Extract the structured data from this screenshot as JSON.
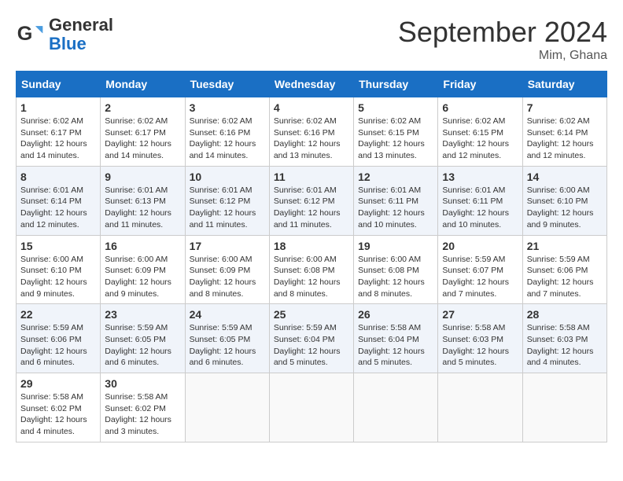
{
  "logo": {
    "text_general": "General",
    "text_blue": "Blue"
  },
  "title": "September 2024",
  "location": "Mim, Ghana",
  "days_of_week": [
    "Sunday",
    "Monday",
    "Tuesday",
    "Wednesday",
    "Thursday",
    "Friday",
    "Saturday"
  ],
  "weeks": [
    [
      {
        "day": "1",
        "sunrise": "6:02 AM",
        "sunset": "6:17 PM",
        "daylight": "12 hours and 14 minutes."
      },
      {
        "day": "2",
        "sunrise": "6:02 AM",
        "sunset": "6:17 PM",
        "daylight": "12 hours and 14 minutes."
      },
      {
        "day": "3",
        "sunrise": "6:02 AM",
        "sunset": "6:16 PM",
        "daylight": "12 hours and 14 minutes."
      },
      {
        "day": "4",
        "sunrise": "6:02 AM",
        "sunset": "6:16 PM",
        "daylight": "12 hours and 13 minutes."
      },
      {
        "day": "5",
        "sunrise": "6:02 AM",
        "sunset": "6:15 PM",
        "daylight": "12 hours and 13 minutes."
      },
      {
        "day": "6",
        "sunrise": "6:02 AM",
        "sunset": "6:15 PM",
        "daylight": "12 hours and 12 minutes."
      },
      {
        "day": "7",
        "sunrise": "6:02 AM",
        "sunset": "6:14 PM",
        "daylight": "12 hours and 12 minutes."
      }
    ],
    [
      {
        "day": "8",
        "sunrise": "6:01 AM",
        "sunset": "6:14 PM",
        "daylight": "12 hours and 12 minutes."
      },
      {
        "day": "9",
        "sunrise": "6:01 AM",
        "sunset": "6:13 PM",
        "daylight": "12 hours and 11 minutes."
      },
      {
        "day": "10",
        "sunrise": "6:01 AM",
        "sunset": "6:12 PM",
        "daylight": "12 hours and 11 minutes."
      },
      {
        "day": "11",
        "sunrise": "6:01 AM",
        "sunset": "6:12 PM",
        "daylight": "12 hours and 11 minutes."
      },
      {
        "day": "12",
        "sunrise": "6:01 AM",
        "sunset": "6:11 PM",
        "daylight": "12 hours and 10 minutes."
      },
      {
        "day": "13",
        "sunrise": "6:01 AM",
        "sunset": "6:11 PM",
        "daylight": "12 hours and 10 minutes."
      },
      {
        "day": "14",
        "sunrise": "6:00 AM",
        "sunset": "6:10 PM",
        "daylight": "12 hours and 9 minutes."
      }
    ],
    [
      {
        "day": "15",
        "sunrise": "6:00 AM",
        "sunset": "6:10 PM",
        "daylight": "12 hours and 9 minutes."
      },
      {
        "day": "16",
        "sunrise": "6:00 AM",
        "sunset": "6:09 PM",
        "daylight": "12 hours and 9 minutes."
      },
      {
        "day": "17",
        "sunrise": "6:00 AM",
        "sunset": "6:09 PM",
        "daylight": "12 hours and 8 minutes."
      },
      {
        "day": "18",
        "sunrise": "6:00 AM",
        "sunset": "6:08 PM",
        "daylight": "12 hours and 8 minutes."
      },
      {
        "day": "19",
        "sunrise": "6:00 AM",
        "sunset": "6:08 PM",
        "daylight": "12 hours and 8 minutes."
      },
      {
        "day": "20",
        "sunrise": "5:59 AM",
        "sunset": "6:07 PM",
        "daylight": "12 hours and 7 minutes."
      },
      {
        "day": "21",
        "sunrise": "5:59 AM",
        "sunset": "6:06 PM",
        "daylight": "12 hours and 7 minutes."
      }
    ],
    [
      {
        "day": "22",
        "sunrise": "5:59 AM",
        "sunset": "6:06 PM",
        "daylight": "12 hours and 6 minutes."
      },
      {
        "day": "23",
        "sunrise": "5:59 AM",
        "sunset": "6:05 PM",
        "daylight": "12 hours and 6 minutes."
      },
      {
        "day": "24",
        "sunrise": "5:59 AM",
        "sunset": "6:05 PM",
        "daylight": "12 hours and 6 minutes."
      },
      {
        "day": "25",
        "sunrise": "5:59 AM",
        "sunset": "6:04 PM",
        "daylight": "12 hours and 5 minutes."
      },
      {
        "day": "26",
        "sunrise": "5:58 AM",
        "sunset": "6:04 PM",
        "daylight": "12 hours and 5 minutes."
      },
      {
        "day": "27",
        "sunrise": "5:58 AM",
        "sunset": "6:03 PM",
        "daylight": "12 hours and 5 minutes."
      },
      {
        "day": "28",
        "sunrise": "5:58 AM",
        "sunset": "6:03 PM",
        "daylight": "12 hours and 4 minutes."
      }
    ],
    [
      {
        "day": "29",
        "sunrise": "5:58 AM",
        "sunset": "6:02 PM",
        "daylight": "12 hours and 4 minutes."
      },
      {
        "day": "30",
        "sunrise": "5:58 AM",
        "sunset": "6:02 PM",
        "daylight": "12 hours and 3 minutes."
      },
      null,
      null,
      null,
      null,
      null
    ]
  ]
}
